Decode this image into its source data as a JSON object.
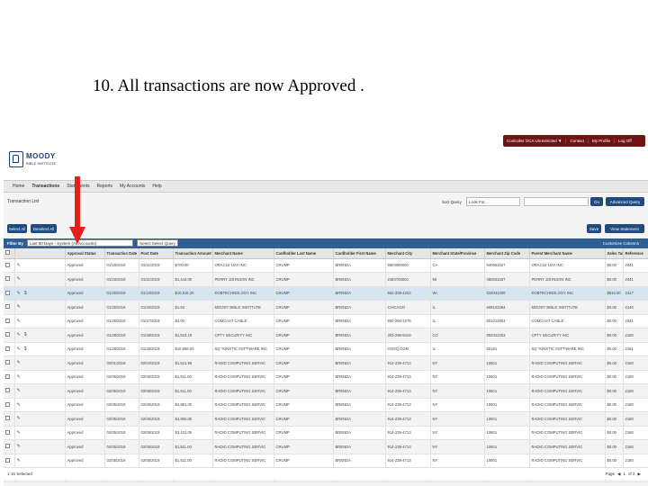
{
  "slide": {
    "title": "10. All transactions are now Approved ."
  },
  "header": {
    "logo_name": "MOODY",
    "logo_sub": "BIBLE INSTITUTE",
    "topbar": [
      "Controller OCA Unrestricted ▼",
      "Contact",
      "My Profile",
      "Log Off"
    ]
  },
  "nav": [
    "Home",
    "Transactions",
    "Statements",
    "Reports",
    "My Accounts",
    "Help"
  ],
  "section": {
    "title": "Transaction List",
    "sort_label": "Sort Query",
    "sort_value": "Look For...",
    "go_label": "Go",
    "advanced_label": "Advanced Query"
  },
  "toolbar": {
    "select_all": "Select All",
    "deselect_all": "Deselect All",
    "save": "Save",
    "view_statement": "View Statement"
  },
  "filter": {
    "label": "Filter By",
    "value": "Last 90 Days - System (All Accounts)",
    "select_query": "Select Select Query",
    "customize": "Customize Columns"
  },
  "grid": {
    "columns": [
      "",
      "",
      "Approval Status",
      "Transaction Date",
      "Post Date",
      "Transaction Amount",
      "Merchant Name",
      "Cardholder Last Name",
      "Cardholder First Name",
      "Merchant City",
      "Merchant State/Province",
      "Merchant Zip Code",
      "Parent Merchant Name",
      "Sales Tax",
      "Reference"
    ],
    "rows": [
      {
        "dollar": "",
        "status": "Approved",
        "tdate": "01/18/2019",
        "pdate": "01/21/2019",
        "amount": "$700.00",
        "merchant": "ORACLE USA INC",
        "last": "CRUMP",
        "first": "BRENDA",
        "city": "6504060000",
        "state": "CA",
        "zip": "940651627",
        "parent": "ORACLE USA INC",
        "tax": "$0.00",
        "ref": "2441"
      },
      {
        "dollar": "",
        "status": "Approved",
        "tdate": "01/19/2019",
        "pdate": "01/21/2019",
        "amount": "$1,444.00",
        "merchant": "PERRY JOHNSON INC",
        "last": "CRUMP",
        "first": "BRENDA",
        "city": "2484700000",
        "state": "MI",
        "zip": "480831537",
        "parent": "PERRY JOHNSON INC",
        "tax": "$0.00",
        "ref": "2441"
      },
      {
        "dollar": "$",
        "status": "Approved",
        "tdate": "01/25/2019",
        "pdate": "01/24/2019",
        "amount": "$10,516.20",
        "merchant": "DOBTECHNOLOGY INC",
        "last": "CRUMP",
        "first": "BRENDA",
        "city": "562-339-4222",
        "state": "WI",
        "zip": "534041000",
        "parent": "DOBTECHNOLOGY INC",
        "tax": "$816.00",
        "ref": "2417"
      },
      {
        "dollar": "",
        "status": "Approved",
        "tdate": "01/25/2019",
        "pdate": "01/25/2019",
        "amount": "$1.53",
        "merchant": "MOODY BIBLE INSTITUTE",
        "last": "CRUMP",
        "first": "BRENDA",
        "city": "CHICAGO",
        "state": "IL",
        "zip": "606102284",
        "parent": "MOODY BIBLE INSTITUTE",
        "tax": "$0.00",
        "ref": "2140"
      },
      {
        "dollar": "",
        "status": "Approved",
        "tdate": "01/26/2019",
        "pdate": "01/27/2019",
        "amount": "$3.00",
        "merchant": "COMCAST CABLE",
        "last": "CRUMP",
        "first": "BRENDA",
        "city": "800-266-2278",
        "state": "IL",
        "zip": "601013004",
        "parent": "COMCAST CABLE",
        "tax": "$0.00",
        "ref": "2441"
      },
      {
        "dollar": "$",
        "status": "Approved",
        "tdate": "01/28/2019",
        "pdate": "01/28/2019",
        "amount": "$1,523.19",
        "merchant": "CPTY SECURITY INC",
        "last": "CRUMP",
        "first": "BRENDA",
        "city": "303-298-9419",
        "state": "CO",
        "zip": "802022253",
        "parent": "CPTY SECURITY INC",
        "tax": "$0.00",
        "ref": "2180"
      },
      {
        "dollar": "$",
        "status": "Approved",
        "tdate": "01/28/2019",
        "pdate": "01/28/2019",
        "amount": "$10,668.00",
        "merchant": "SQ *KINETIC SOFTWARE INC",
        "last": "CRUMP",
        "first": "BRENDA",
        "city": "GOSQ.COM",
        "state": "IL",
        "zip": "60181",
        "parent": "SQ *KINETIC SOFTWARE INC",
        "tax": "$0.00",
        "ref": "2181"
      },
      {
        "dollar": "",
        "status": "Approved",
        "tdate": "02/01/2019",
        "pdate": "02/04/2019",
        "amount": "$1,521.90",
        "merchant": "RADIO COMPUTING SERVIC",
        "last": "CRUMP",
        "first": "BRENDA",
        "city": "914-239-4713",
        "state": "NY",
        "zip": "10601",
        "parent": "RADIO COMPUTING SERVIC",
        "tax": "$0.00",
        "ref": "2180"
      },
      {
        "dollar": "",
        "status": "Approved",
        "tdate": "02/05/2019",
        "pdate": "02/05/2019",
        "amount": "$1,511.00",
        "merchant": "RADIO COMPUTING SERVIC",
        "last": "CRUMP",
        "first": "BRENDA",
        "city": "914-239-4713",
        "state": "NY",
        "zip": "10601",
        "parent": "RADIO COMPUTING SERVIC",
        "tax": "$0.00",
        "ref": "2180"
      },
      {
        "dollar": "",
        "status": "Approved",
        "tdate": "02/05/2019",
        "pdate": "02/05/2019",
        "amount": "$1,511.00",
        "merchant": "RADIO COMPUTING SERVIC",
        "last": "CRUMP",
        "first": "BRENDA",
        "city": "914-239-4713",
        "state": "NY",
        "zip": "10601",
        "parent": "RADIO COMPUTING SERVIC",
        "tax": "$0.00",
        "ref": "2180"
      },
      {
        "dollar": "",
        "status": "Approved",
        "tdate": "02/05/2019",
        "pdate": "02/05/2019",
        "amount": "$4,981.00",
        "merchant": "RADIO COMPUTING SERVIC",
        "last": "CRUMP",
        "first": "BRENDA",
        "city": "914-239-4713",
        "state": "NY",
        "zip": "10601",
        "parent": "RADIO COMPUTING SERVIC",
        "tax": "$0.00",
        "ref": "2180"
      },
      {
        "dollar": "",
        "status": "Approved",
        "tdate": "02/05/2019",
        "pdate": "02/05/2019",
        "amount": "$4,950.00",
        "merchant": "RADIO COMPUTING SERVIC",
        "last": "CRUMP",
        "first": "BRENDA",
        "city": "914-239-4713",
        "state": "NY",
        "zip": "10601",
        "parent": "RADIO COMPUTING SERVIC",
        "tax": "$0.00",
        "ref": "2180"
      },
      {
        "dollar": "",
        "status": "Approved",
        "tdate": "02/05/2019",
        "pdate": "02/05/2019",
        "amount": "$3,431.00",
        "merchant": "RADIO COMPUTING SERVIC",
        "last": "CRUMP",
        "first": "BRENDA",
        "city": "914-239-4713",
        "state": "NY",
        "zip": "10601",
        "parent": "RADIO COMPUTING SERVIC",
        "tax": "$0.00",
        "ref": "2180"
      },
      {
        "dollar": "",
        "status": "Approved",
        "tdate": "02/05/2019",
        "pdate": "02/05/2019",
        "amount": "$1,511.00",
        "merchant": "RADIO COMPUTING SERVIC",
        "last": "CRUMP",
        "first": "BRENDA",
        "city": "914-239-4713",
        "state": "NY",
        "zip": "10601",
        "parent": "RADIO COMPUTING SERVIC",
        "tax": "$0.00",
        "ref": "2180"
      },
      {
        "dollar": "",
        "status": "Approved",
        "tdate": "02/05/2019",
        "pdate": "02/05/2019",
        "amount": "$1,511.00",
        "merchant": "RADIO COMPUTING SERVIC",
        "last": "CRUMP",
        "first": "BRENDA",
        "city": "914-239-4713",
        "state": "NY",
        "zip": "10601",
        "parent": "RADIO COMPUTING SERVIC",
        "tax": "$0.00",
        "ref": "2180"
      },
      {
        "dollar": "$",
        "status": "Approved",
        "tdate": "02/11/2019",
        "pdate": "02/12/2019",
        "amount": "$1,566.80",
        "merchant": "AT&T BILL PAYMENT",
        "last": "CRUMP",
        "first": "BRENDA",
        "city": "800-331-0500",
        "state": "TX",
        "zip": "752024227",
        "parent": "AT&T BILL PAYMENT",
        "tax": "$14.24",
        "ref": "2140"
      }
    ]
  },
  "footer": {
    "selected": "1-16 Selected",
    "page_label": "Page",
    "page_value": "1",
    "of_label": "of 2"
  }
}
